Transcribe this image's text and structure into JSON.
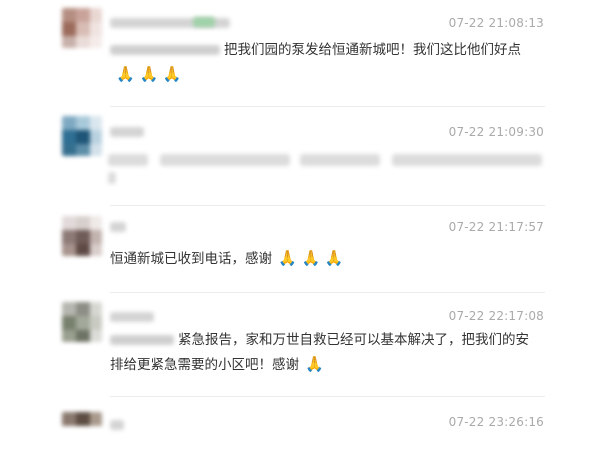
{
  "comments": [
    {
      "time": "07-22 21:08:13",
      "text": "把我们园的泵发给恒通新城吧！我们这比他们好点",
      "emojis": "🙏 🙏 🙏"
    },
    {
      "time": "07-22 21:09:30",
      "text": "",
      "emojis": ""
    },
    {
      "time": "07-22 21:17:57",
      "text": "恒通新城已收到电话，感谢",
      "emojis": "🙏 🙏 🙏"
    },
    {
      "time": "07-22 22:17:08",
      "text": "紧急报告，家和万世自救已经可以基本解决了，把我们的安排给更紧急需要的小区吧！感谢",
      "emojis": "🙏"
    },
    {
      "time": "07-22 23:26:16",
      "text": "",
      "emojis": ""
    }
  ],
  "colors": {
    "time_text": "#aaaaaa",
    "body_text": "#333333",
    "divider": "#ececec"
  }
}
